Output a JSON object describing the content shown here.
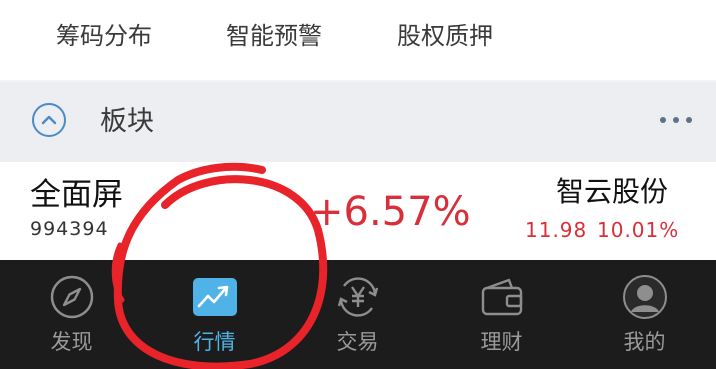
{
  "shortcuts": [
    {
      "label": "筹码分布"
    },
    {
      "label": "智能预警"
    },
    {
      "label": "股权质押"
    }
  ],
  "section": {
    "title": "板块",
    "collapse_icon": "chevron-up-icon",
    "more_icon": "more-dots-icon"
  },
  "sector_row": {
    "name": "全面屏",
    "code": "994394",
    "change": "+6.57%",
    "leader_name": "智云股份",
    "leader_price": "11.98",
    "leader_change": "10.01%"
  },
  "tabbar": {
    "active_index": 1,
    "tabs": [
      {
        "label": "发现",
        "icon": "compass-icon"
      },
      {
        "label": "行情",
        "icon": "market-chart-icon"
      },
      {
        "label": "交易",
        "icon": "yen-exchange-icon"
      },
      {
        "label": "理财",
        "icon": "wallet-icon"
      },
      {
        "label": "我的",
        "icon": "user-avatar-icon"
      }
    ]
  },
  "colors": {
    "rise": "#d8303a",
    "active_tab": "#4fb3e8",
    "tabbar_bg": "#1c1c1c",
    "annotation": "#e8232a"
  }
}
